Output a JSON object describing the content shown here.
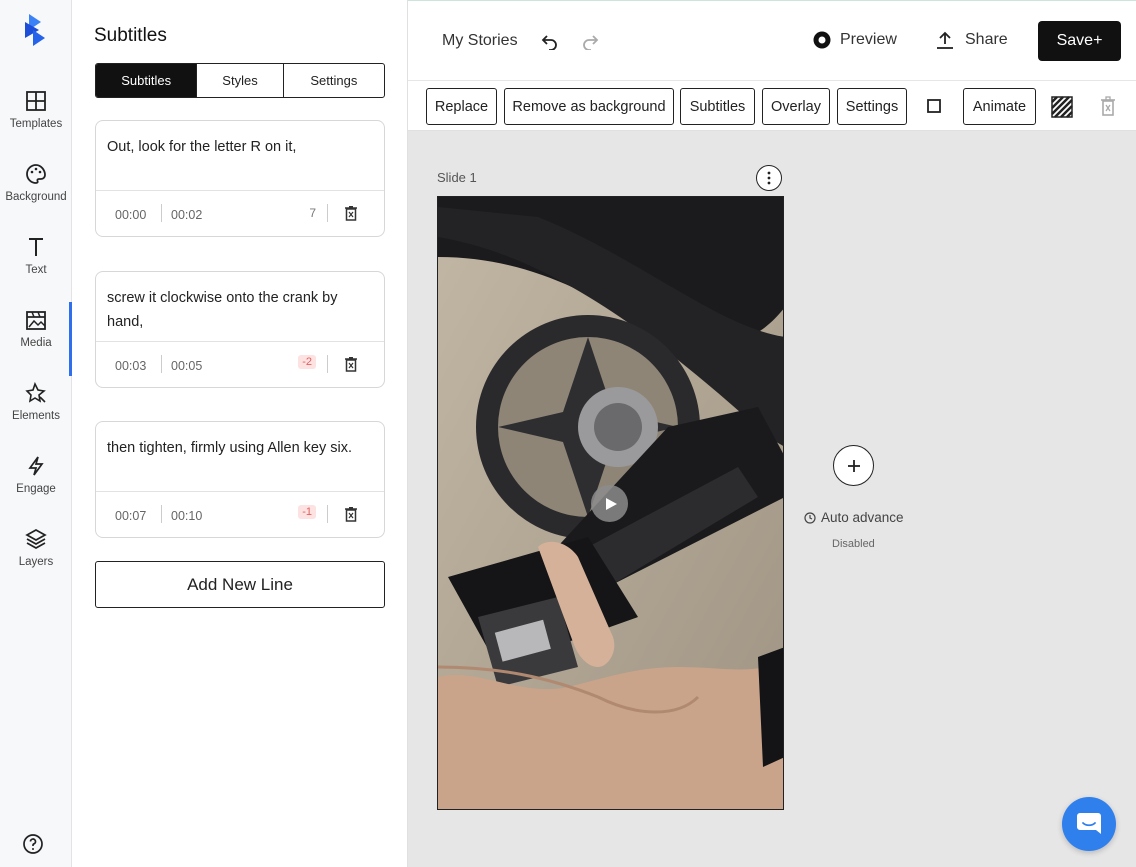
{
  "rail": {
    "items": [
      {
        "label": "Templates",
        "icon": "templates-icon"
      },
      {
        "label": "Background",
        "icon": "palette-icon"
      },
      {
        "label": "Text",
        "icon": "text-icon"
      },
      {
        "label": "Media",
        "icon": "media-icon"
      },
      {
        "label": "Elements",
        "icon": "elements-icon"
      },
      {
        "label": "Engage",
        "icon": "bolt-icon"
      },
      {
        "label": "Layers",
        "icon": "layers-icon"
      }
    ],
    "active": "Media"
  },
  "panel": {
    "title": "Subtitles",
    "tabs": [
      "Subtitles",
      "Styles",
      "Settings"
    ],
    "active_tab": "Subtitles",
    "lines": [
      {
        "text": "Out, look for the letter R on it,",
        "start": "00:00",
        "end": "00:02",
        "count": "7"
      },
      {
        "text": "screw it clockwise onto the crank by hand,",
        "start": "00:03",
        "end": "00:05",
        "count": "-2"
      },
      {
        "text": "then tighten, firmly using Allen key six.",
        "start": "00:07",
        "end": "00:10",
        "count": "-1"
      }
    ],
    "add_label": "Add New Line"
  },
  "topbar": {
    "my_stories": "My Stories",
    "preview": "Preview",
    "share": "Share",
    "save": "Save+"
  },
  "toolbar": {
    "buttons": [
      "Replace",
      "Remove as background",
      "Subtitles",
      "Overlay",
      "Settings",
      "Animate"
    ]
  },
  "canvas": {
    "slide_label": "Slide 1",
    "auto_advance": "Auto advance",
    "auto_status": "Disabled"
  },
  "colors": {
    "accent": "#2f6fed",
    "dark": "#111111",
    "chat": "#2f80ed",
    "negative_badge_bg": "#fde2e2",
    "negative_badge_fg": "#e06060"
  }
}
